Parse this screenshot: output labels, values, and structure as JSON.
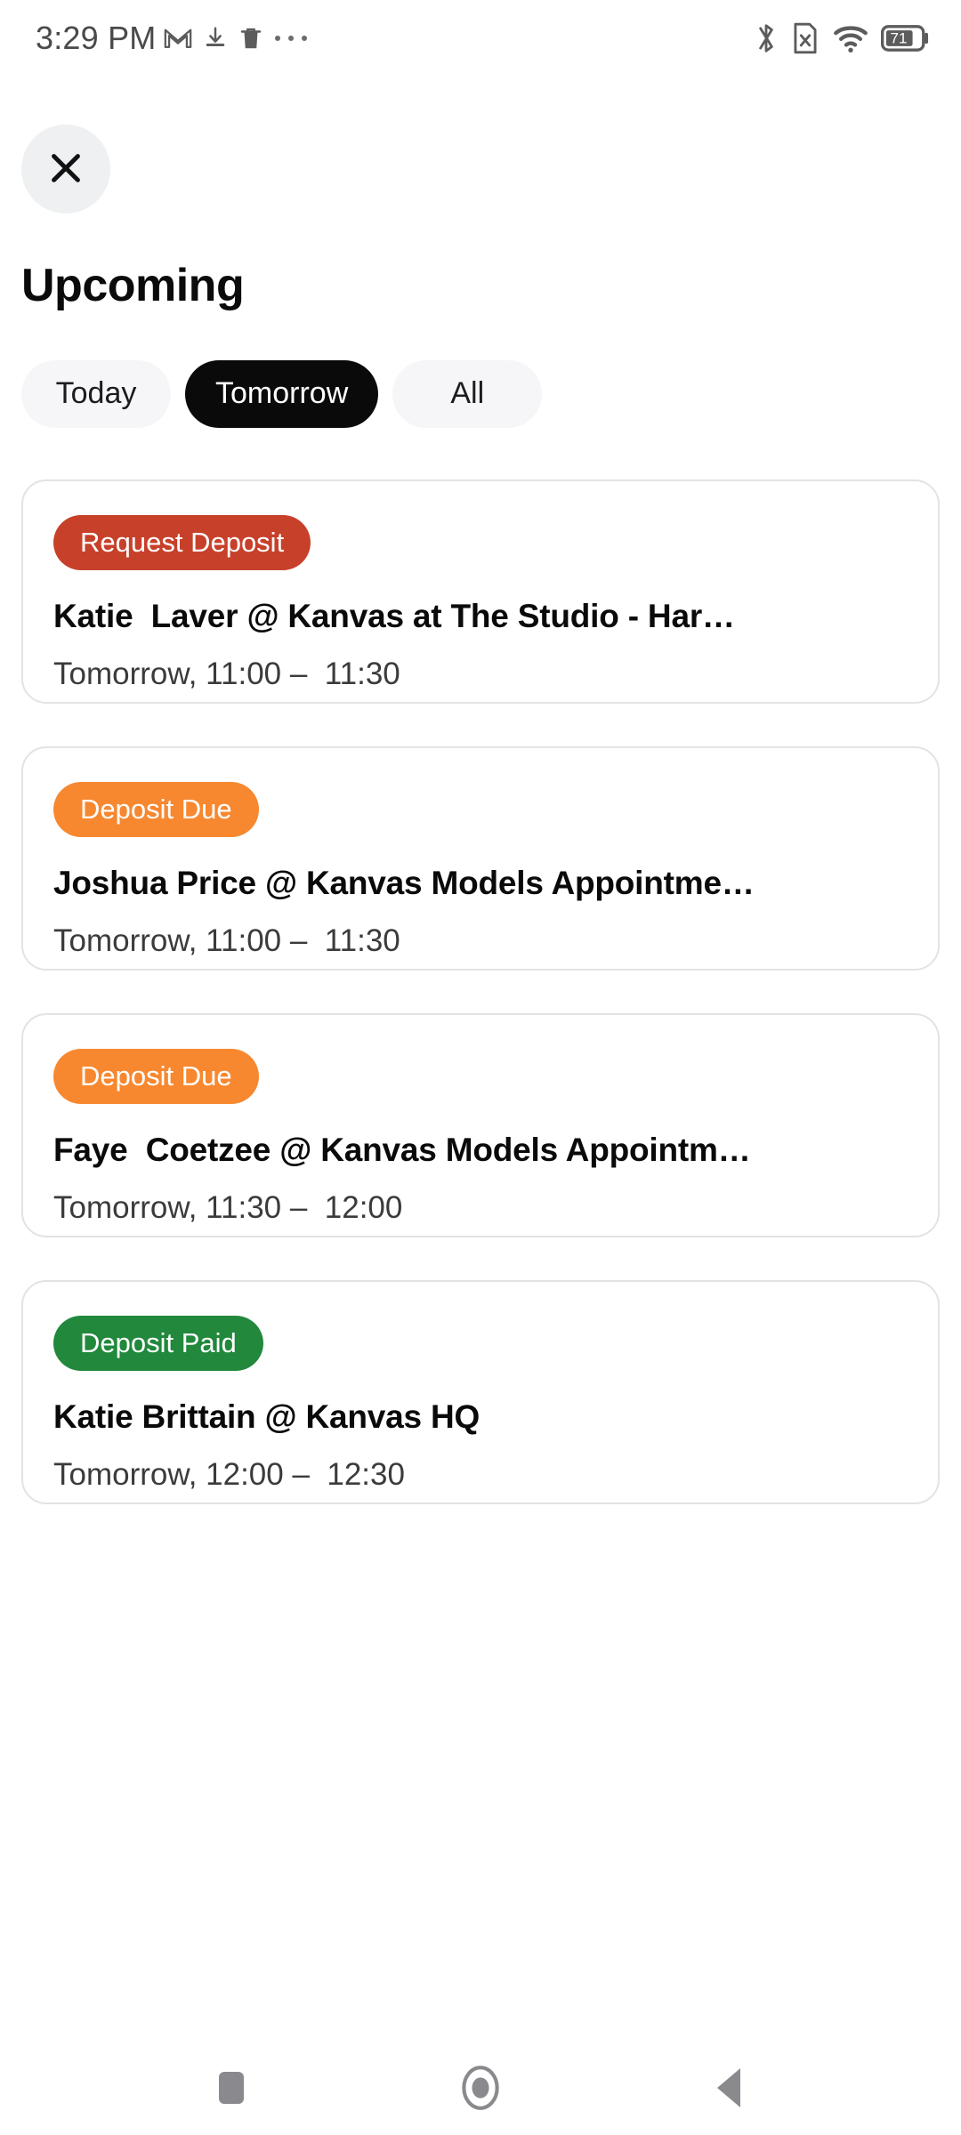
{
  "status_bar": {
    "time": "3:29 PM",
    "battery_percent": "71",
    "left_icons": [
      "gmail-icon",
      "download-icon",
      "trash-icon",
      "more-dots-icon"
    ],
    "right_icons": [
      "bluetooth-icon",
      "sim-missing-icon",
      "wifi-icon",
      "battery-icon"
    ]
  },
  "header": {
    "close_icon": "close-icon",
    "title": "Upcoming"
  },
  "tabs": [
    {
      "label": "Today",
      "active": false,
      "name": "tab-today"
    },
    {
      "label": "Tomorrow",
      "active": true,
      "name": "tab-tomorrow"
    },
    {
      "label": "All",
      "active": false,
      "name": "tab-all"
    }
  ],
  "colors": {
    "badge_request_deposit": "#c7402a",
    "badge_deposit_due": "#f7882f",
    "badge_deposit_paid": "#21883c",
    "tab_active_bg": "#0a0a0a",
    "tab_inactive_bg": "#f6f6f8",
    "card_border": "#e2e3e5",
    "nav_icon": "#8a8a8e",
    "time_text": "#3b3b3b",
    "status_text": "#4a4a4a"
  },
  "appointments": [
    {
      "badge": "Request Deposit",
      "badge_color": "#c7402a",
      "title": "Katie  Laver @ Kanvas at The Studio - Har…",
      "time": "Tomorrow, 11:00 –  11:30"
    },
    {
      "badge": "Deposit Due",
      "badge_color": "#f7882f",
      "title": "Joshua Price @ Kanvas Models Appointme…",
      "time": "Tomorrow, 11:00 –  11:30"
    },
    {
      "badge": "Deposit Due",
      "badge_color": "#f7882f",
      "title": "Faye  Coetzee @ Kanvas Models Appointm…",
      "time": "Tomorrow, 11:30 –  12:00"
    },
    {
      "badge": "Deposit Paid",
      "badge_color": "#21883c",
      "title": "Katie Brittain @ Kanvas HQ",
      "time": "Tomorrow, 12:00 –  12:30"
    }
  ],
  "nav_bar": {
    "recents_icon": "square-recents-icon",
    "home_icon": "circle-home-icon",
    "back_icon": "triangle-back-icon"
  }
}
